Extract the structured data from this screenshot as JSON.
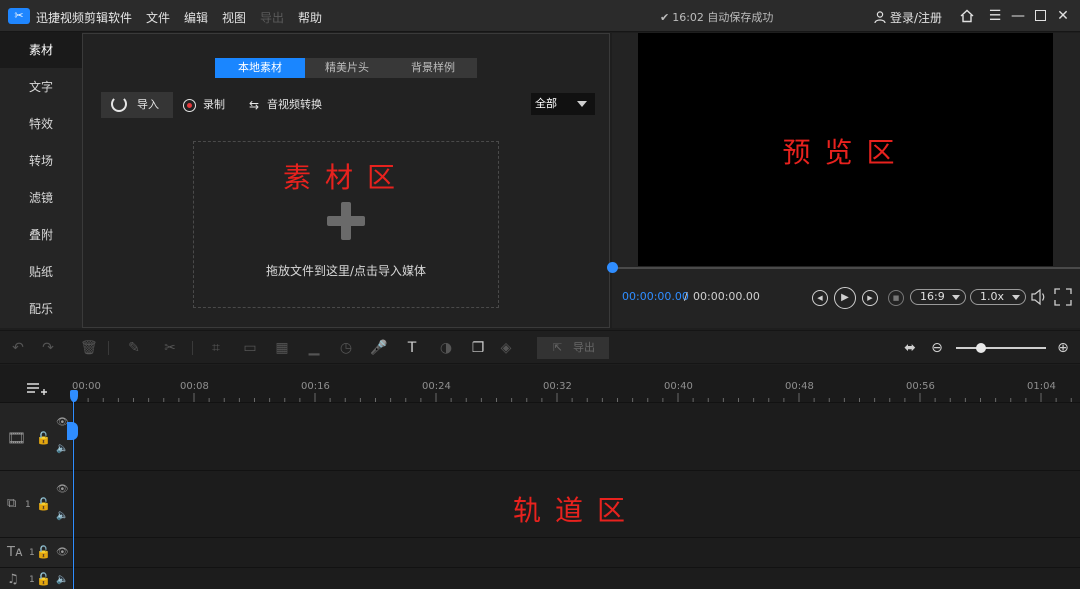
{
  "titlebar": {
    "logo_text": "✂",
    "app_title": "迅捷视频剪辑软件",
    "menus": [
      "文件",
      "编辑",
      "视图",
      "导出",
      "帮助"
    ],
    "save_status": "16:02 自动保存成功",
    "user_login": "登录/注册"
  },
  "sidebar": {
    "items": [
      "素材",
      "文字",
      "特效",
      "转场",
      "滤镜",
      "叠附",
      "贴纸",
      "配乐"
    ]
  },
  "media_panel": {
    "tabs": [
      "本地素材",
      "精美片头",
      "背景样例"
    ],
    "import_label": "导入",
    "record_label": "录制",
    "convert_label": "音视频转换",
    "filter_value": "全部",
    "zone_label": "素材区",
    "drop_hint": "拖放文件到这里/点击导入媒体"
  },
  "preview": {
    "zone_label": "预览区",
    "time_current": "00:00:00.00",
    "time_sep": "/",
    "time_total": "00:00:00.00",
    "aspect_ratio": "16:9",
    "speed": "1.0x"
  },
  "timeline": {
    "export_label": "导出",
    "ruler_ticks": [
      "00:00",
      "00:08",
      "00:16",
      "00:24",
      "00:32",
      "00:40",
      "00:48",
      "00:56",
      "01:04"
    ],
    "track_numbers": [
      "1",
      "1",
      "1"
    ],
    "zone_label": "轨道区"
  },
  "colors": {
    "accent": "#1a86ff",
    "zone_label": "#e8221e",
    "background": "#1e1e1e"
  }
}
